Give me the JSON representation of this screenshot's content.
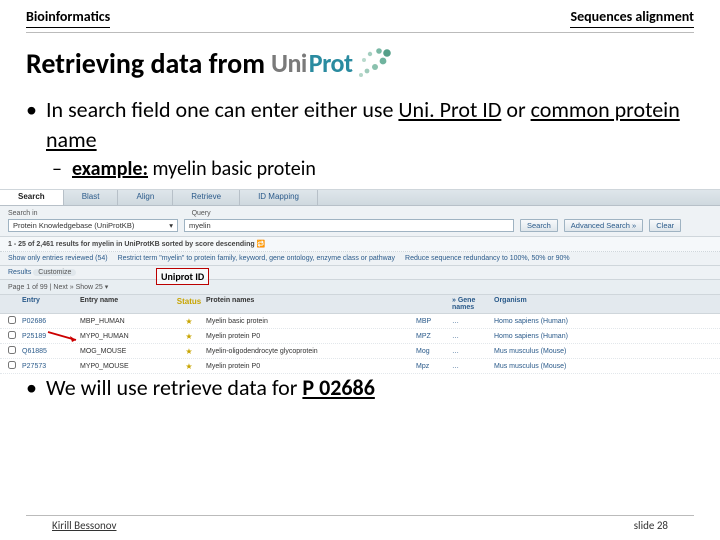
{
  "header": {
    "left": "Bioinformatics",
    "right": "Sequences alignment"
  },
  "title": {
    "text": "Retrieving data from",
    "logo_left": "Uni",
    "logo_right": "Prot"
  },
  "bullets": {
    "b1_part1": "In search field one can enter either use ",
    "b1_u1": "Uni. Prot ID",
    "b1_mid": " or ",
    "b1_u2": "common protein name",
    "sub_label": "example:",
    "sub_text": " myelin basic protein",
    "b2_part1": "We will use retrieve data for ",
    "b2_u": "P 02686"
  },
  "screenshot": {
    "tabs": [
      "Search",
      "Blast",
      "Align",
      "Retrieve",
      "ID Mapping"
    ],
    "search_in_label": "Search in",
    "query_label": "Query",
    "kb_select": "Protein Knowledgebase (UniProtKB)",
    "query_value": "myelin",
    "buttons": {
      "search": "Search",
      "advanced": "Advanced Search »",
      "clear": "Clear"
    },
    "results_line": "1 - 25 of 2,461 results for myelin in UniProtKB sorted by score descending ",
    "filters": {
      "results_label": "Results",
      "customize_pill": "Customize",
      "show_only": "Show only entries reviewed (54) ",
      "restrict": "Restrict term \"myelin\" to protein family, keyword, gene ontology, enzyme class or pathway",
      "reduce": "Reduce sequence redundancy to 100%, 50% or 90%"
    },
    "download_line": "Page 1 of 99 | Next »    Show 25 ▾",
    "uniprot_id_label": "Uniprot ID",
    "columns": [
      "",
      "Entry",
      "Entry name",
      "Status",
      "Protein names",
      "",
      "» Gene names",
      "Organism"
    ],
    "rows": [
      {
        "entry": "P02686",
        "enname": "MBP_HUMAN",
        "pname": "Myelin basic protein",
        "gene": "MBP",
        "org": "Homo sapiens (Human)"
      },
      {
        "entry": "P25189",
        "enname": "MYP0_HUMAN",
        "pname": "Myelin protein P0",
        "gene": "MPZ",
        "org": "Homo sapiens (Human)"
      },
      {
        "entry": "Q61885",
        "enname": "MOG_MOUSE",
        "pname": "Myelin-oligodendrocyte glycoprotein",
        "gene": "Mog",
        "org": "Mus musculus (Mouse)"
      },
      {
        "entry": "P27573",
        "enname": "MYP0_MOUSE",
        "pname": "Myelin protein P0",
        "gene": "Mpz",
        "org": "Mus musculus (Mouse)"
      }
    ]
  },
  "footer": {
    "author": "Kirill Bessonov",
    "slide": "slide 28"
  }
}
